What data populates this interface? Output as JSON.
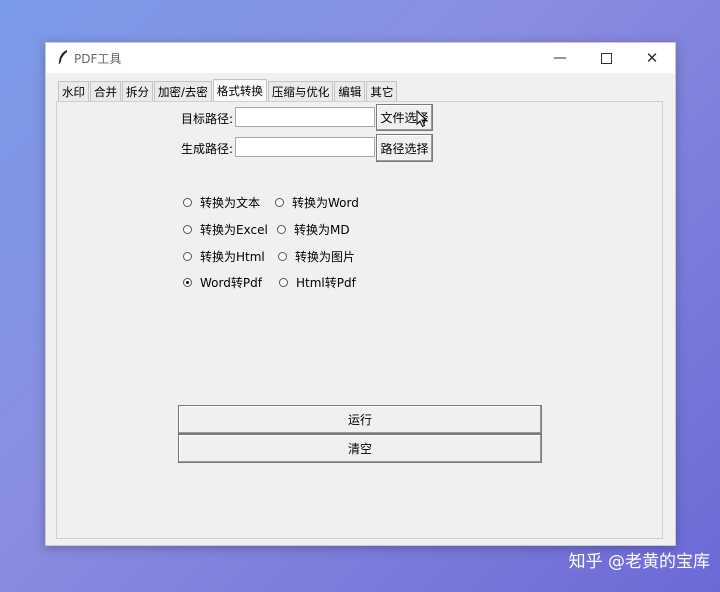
{
  "window": {
    "title": "PDF工具"
  },
  "tabs": [
    {
      "label": "水印"
    },
    {
      "label": "合并"
    },
    {
      "label": "拆分"
    },
    {
      "label": "加密/去密"
    },
    {
      "label": "格式转换"
    },
    {
      "label": "压缩与优化"
    },
    {
      "label": "编辑"
    },
    {
      "label": "其它"
    }
  ],
  "active_tab": "格式转换",
  "form": {
    "target_label": "目标路径:",
    "target_value": "",
    "file_select_button": "文件选择",
    "output_label": "生成路径:",
    "output_value": "",
    "path_select_button": "路径选择"
  },
  "options": [
    {
      "label": "转换为文本",
      "selected": false
    },
    {
      "label": "转换为Word",
      "selected": false
    },
    {
      "label": "转换为Excel",
      "selected": false
    },
    {
      "label": "转换为MD",
      "selected": false
    },
    {
      "label": "转换为Html",
      "selected": false
    },
    {
      "label": "转换为图片",
      "selected": false
    },
    {
      "label": "Word转Pdf",
      "selected": true
    },
    {
      "label": "Html转Pdf",
      "selected": false
    }
  ],
  "actions": {
    "run": "运行",
    "clear": "清空"
  },
  "watermark": "知乎 @老黄的宝库"
}
